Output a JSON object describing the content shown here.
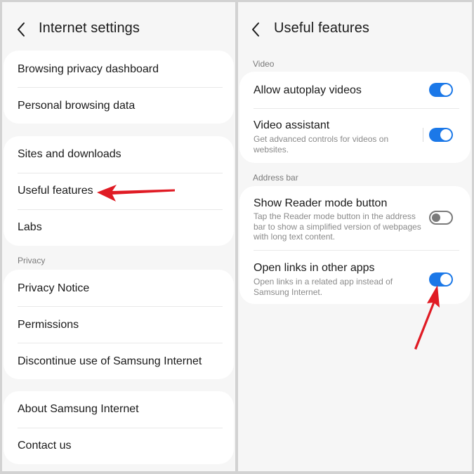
{
  "left_panel": {
    "title": "Internet settings",
    "group1": [
      "Browsing privacy dashboard",
      "Personal browsing data"
    ],
    "group2": [
      "Sites and downloads",
      "Useful features",
      "Labs"
    ],
    "privacy_section": "Privacy",
    "group3": [
      "Privacy Notice",
      "Permissions",
      "Discontinue use of Samsung Internet"
    ],
    "group4": [
      "About Samsung Internet",
      "Contact us"
    ]
  },
  "right_panel": {
    "title": "Useful features",
    "video_section": "Video",
    "video_items": [
      {
        "label": "Allow autoplay videos",
        "desc": "",
        "enabled": true
      },
      {
        "label": "Video assistant",
        "desc": "Get advanced controls for videos on websites.",
        "enabled": true
      }
    ],
    "address_section": "Address bar",
    "address_items": [
      {
        "label": "Show Reader mode button",
        "desc": "Tap the Reader mode button in the address bar to show a simplified version of webpages with long text content.",
        "enabled": false
      },
      {
        "label": "Open links in other apps",
        "desc": "Open links in a related app instead of Samsung Internet.",
        "enabled": true
      }
    ]
  },
  "colors": {
    "accent": "#1b78e8",
    "annotation_arrow": "#e01b24"
  }
}
